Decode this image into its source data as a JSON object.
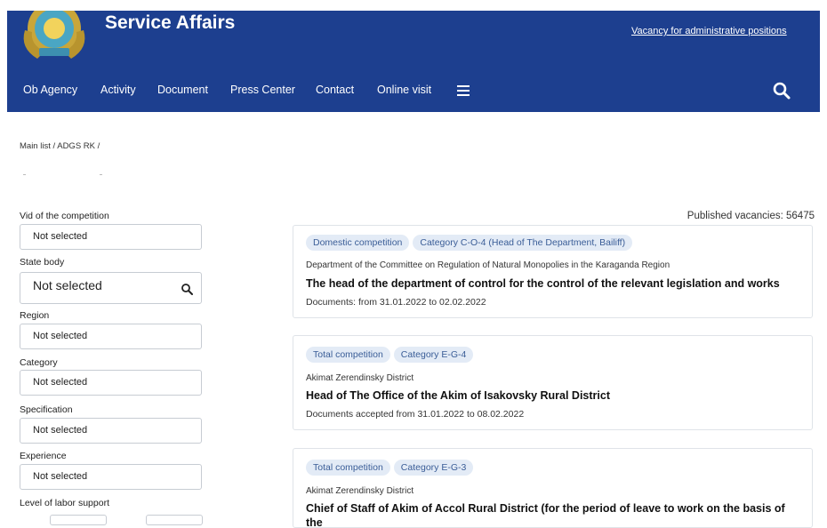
{
  "header": {
    "title": "Service Affairs",
    "vacancy_link": "Vacancy for administrative positions",
    "nav": [
      "Ob Agency",
      "Activity",
      "Document",
      "Press Center",
      "Contact",
      "Online visit"
    ],
    "brand_color": "#1d3f8f",
    "icons": [
      "emblem-icon",
      "menu-icon",
      "search-icon"
    ]
  },
  "breadcrumb": "Main list / ADGS RK /",
  "filters": [
    {
      "label": "Vid of the competition",
      "value": "Not selected"
    },
    {
      "label": "State body",
      "value": "Not selected"
    },
    {
      "label": "Region",
      "value": "Not selected"
    },
    {
      "label": "Category",
      "value": "Not selected"
    },
    {
      "label": "Specification",
      "value": "Not selected"
    },
    {
      "label": "Experience",
      "value": "Not selected"
    },
    {
      "label": "Level of labor support"
    }
  ],
  "published": "Published vacancies: 56475",
  "vacancies": [
    {
      "tags": [
        "Domestic competition",
        "Category C-O-4 (Head of The Department, Bailiff)"
      ],
      "org": "Department of the Committee on Regulation of Natural Monopolies in the Karaganda Region",
      "title": "The head of the department of control for the control of the relevant legislation and works",
      "docs": "Documents: from 31.01.2022 to 02.02.2022"
    },
    {
      "tags": [
        "Total competition",
        "Category E-G-4"
      ],
      "org": "Akimat Zerendinsky District",
      "title": "Head of The Office of the Akim of Isakovsky Rural District",
      "docs": "Documents accepted from 31.01.2022 to 08.02.2022"
    },
    {
      "tags": [
        "Total competition",
        "Category E-G-3"
      ],
      "org": "Akimat Zerendinsky District",
      "title": "Chief of Staff of Akim of Accol Rural District (for the period of leave to work on the basis of the"
    }
  ]
}
